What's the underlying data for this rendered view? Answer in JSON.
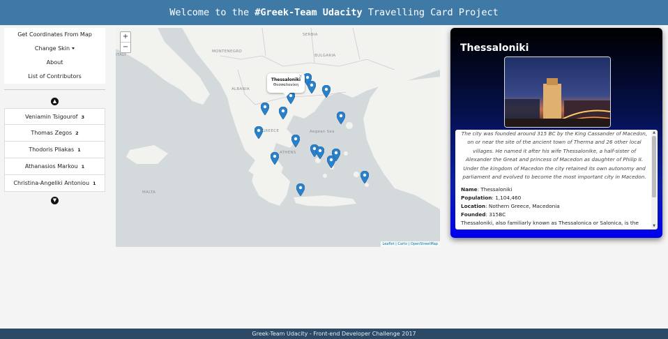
{
  "header": {
    "prefix": "Welcome to the ",
    "highlight": "#Greek-Team Udacity",
    "suffix": " Travelling Card Project"
  },
  "menu": {
    "get_coordinates": "Get Coordinates From Map",
    "change_skin": "Change Skin",
    "about": "About",
    "contributors": "List of Contributors"
  },
  "scroll_up_icon": "arrow-up-circle-icon",
  "scroll_down_icon": "arrow-down-circle-icon",
  "contributors": [
    {
      "name": "Veniamin Tsigourof",
      "count": "3"
    },
    {
      "name": "Thomas Zegos",
      "count": "2"
    },
    {
      "name": "Thodoris Pliakas",
      "count": "1"
    },
    {
      "name": "Athanasios Markou",
      "count": "1"
    },
    {
      "name": "Christina-Angeliki Antoniou",
      "count": "1"
    }
  ],
  "map": {
    "zoom_in": "+",
    "zoom_out": "−",
    "labels": {
      "serbia": "SERBIA",
      "montenegro": "MONTENEGRO",
      "bulgaria": "BULGARIA",
      "italy": "ITALY",
      "albania": "ALBANIA",
      "greece": "GREECE",
      "athens": "ATHENS",
      "aegean": "Aegean Sea",
      "malta": "MALTA"
    },
    "popup": {
      "title": "Thessaloniki",
      "subtitle": "Θεσσαλονίκη",
      "close": "×"
    },
    "attribution": "Leaflet | Carto | OpenStreetMap",
    "marker_color": "#2a81cb"
  },
  "card": {
    "title": "Thessaloniki",
    "description": "The city was founded around 315 BC by the King Cassander of Macedon, on or near the site of the ancient town of Therma and 26 other local villages. He named it after his wife Thessalonike, a half-sister of Alexander the Great and princess of Macedon as daughter of Philip II. Under the kingdom of Macedon the city retained its own autonomy and parliament and evolved to become the most important city in Macedon.",
    "facts": {
      "name_label": "Name",
      "name_value": "Thessaloniki",
      "population_label": "Population",
      "population_value": "1,104,460",
      "location_label": "Location",
      "location_value": "Nothern Greece, Macedonia",
      "founded_label": "Founded",
      "founded_value": "315BC",
      "extra": "Thessaloniki, also familiarly known as Thessalonica or Salonica, is the"
    }
  },
  "footer": "Greek-Team Udacity - Front-end Developer Challenge 2017"
}
